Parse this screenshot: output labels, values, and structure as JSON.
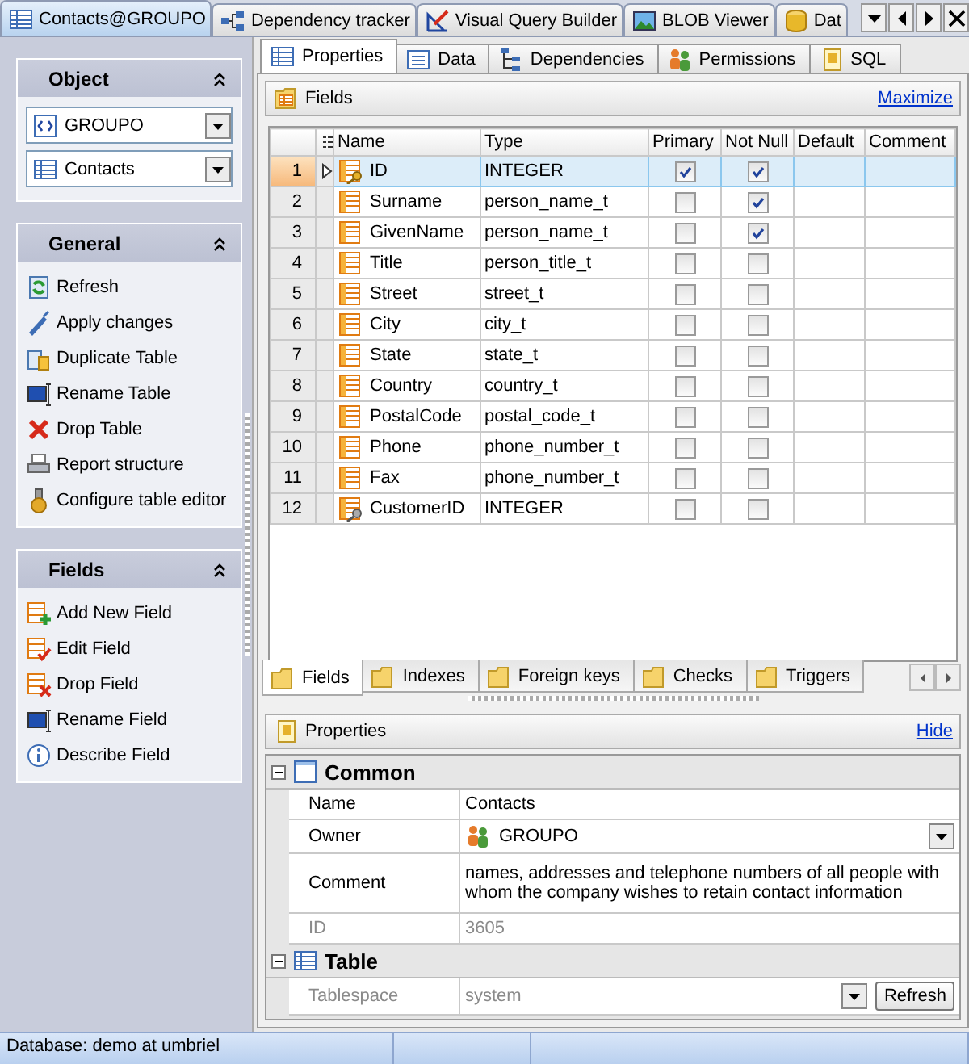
{
  "document_tabs": [
    {
      "label": "Contacts@GROUPO",
      "selected": true
    },
    {
      "label": "Dependency tracker",
      "selected": false
    },
    {
      "label": "Visual Query Builder",
      "selected": false
    },
    {
      "label": "BLOB Viewer",
      "selected": false
    },
    {
      "label": "Dat",
      "selected": false
    }
  ],
  "sidebar": {
    "panels": [
      {
        "title": "Object",
        "kind": "selectors",
        "selectors": [
          "GROUPO",
          "Contacts"
        ]
      },
      {
        "title": "General",
        "kind": "actions",
        "items": [
          "Refresh",
          "Apply changes",
          "Duplicate Table",
          "Rename Table",
          "Drop Table",
          "Report structure",
          "Configure table editor"
        ]
      },
      {
        "title": "Fields",
        "kind": "actions",
        "items": [
          "Add New Field",
          "Edit Field",
          "Drop Field",
          "Rename Field",
          "Describe Field"
        ]
      }
    ]
  },
  "editor_tabs": [
    {
      "label": "Properties",
      "selected": true
    },
    {
      "label": "Data",
      "selected": false
    },
    {
      "label": "Dependencies",
      "selected": false
    },
    {
      "label": "Permissions",
      "selected": false
    },
    {
      "label": "SQL",
      "selected": false
    }
  ],
  "fields_panel": {
    "title": "Fields",
    "link": "Maximize"
  },
  "fields_table": {
    "columns": [
      "Name",
      "Type",
      "Primary",
      "Not Null",
      "Default",
      "Comment"
    ],
    "rows": [
      {
        "number": "1",
        "current": true,
        "kind": "primary_key",
        "name": "ID",
        "type": "INTEGER",
        "primary": true,
        "not_null": true
      },
      {
        "number": "2",
        "current": false,
        "kind": "plain",
        "name": "Surname",
        "type": "person_name_t",
        "primary": false,
        "not_null": true
      },
      {
        "number": "3",
        "current": false,
        "kind": "plain",
        "name": "GivenName",
        "type": "person_name_t",
        "primary": false,
        "not_null": true
      },
      {
        "number": "4",
        "current": false,
        "kind": "plain",
        "name": "Title",
        "type": "person_title_t",
        "primary": false,
        "not_null": false
      },
      {
        "number": "5",
        "current": false,
        "kind": "plain",
        "name": "Street",
        "type": "street_t",
        "primary": false,
        "not_null": false
      },
      {
        "number": "6",
        "current": false,
        "kind": "plain",
        "name": "City",
        "type": "city_t",
        "primary": false,
        "not_null": false
      },
      {
        "number": "7",
        "current": false,
        "kind": "plain",
        "name": "State",
        "type": "state_t",
        "primary": false,
        "not_null": false
      },
      {
        "number": "8",
        "current": false,
        "kind": "plain",
        "name": "Country",
        "type": "country_t",
        "primary": false,
        "not_null": false
      },
      {
        "number": "9",
        "current": false,
        "kind": "plain",
        "name": "PostalCode",
        "type": "postal_code_t",
        "primary": false,
        "not_null": false
      },
      {
        "number": "10",
        "current": false,
        "kind": "plain",
        "name": "Phone",
        "type": "phone_number_t",
        "primary": false,
        "not_null": false
      },
      {
        "number": "11",
        "current": false,
        "kind": "plain",
        "name": "Fax",
        "type": "phone_number_t",
        "primary": false,
        "not_null": false
      },
      {
        "number": "12",
        "current": false,
        "kind": "foreign_key",
        "name": "CustomerID",
        "type": "INTEGER",
        "primary": false,
        "not_null": false
      }
    ]
  },
  "sub_tabs": [
    {
      "label": "Fields",
      "selected": true
    },
    {
      "label": "Indexes",
      "selected": false
    },
    {
      "label": "Foreign keys",
      "selected": false
    },
    {
      "label": "Checks",
      "selected": false
    },
    {
      "label": "Triggers",
      "selected": false
    }
  ],
  "properties_panel": {
    "title": "Properties",
    "link": "Hide"
  },
  "property_groups": [
    {
      "title": "Common",
      "expanded": true,
      "rows": [
        {
          "label": "Name",
          "value": "Contacts",
          "kind": "text",
          "disabled": false
        },
        {
          "label": "Owner",
          "value": "GROUPO",
          "kind": "owner",
          "disabled": false
        },
        {
          "label": "Comment",
          "value": "names, addresses and telephone numbers of all people with whom the company wishes to retain contact information",
          "kind": "text",
          "disabled": false
        },
        {
          "label": "ID",
          "value": "3605",
          "kind": "text",
          "disabled": true
        }
      ]
    },
    {
      "title": "Table",
      "expanded": true,
      "rows": [
        {
          "label": "Tablespace",
          "value": "system",
          "kind": "refresh",
          "button": "Refresh",
          "disabled": true
        }
      ]
    }
  ],
  "status_bar": {
    "text": "Database: demo at umbriel"
  }
}
